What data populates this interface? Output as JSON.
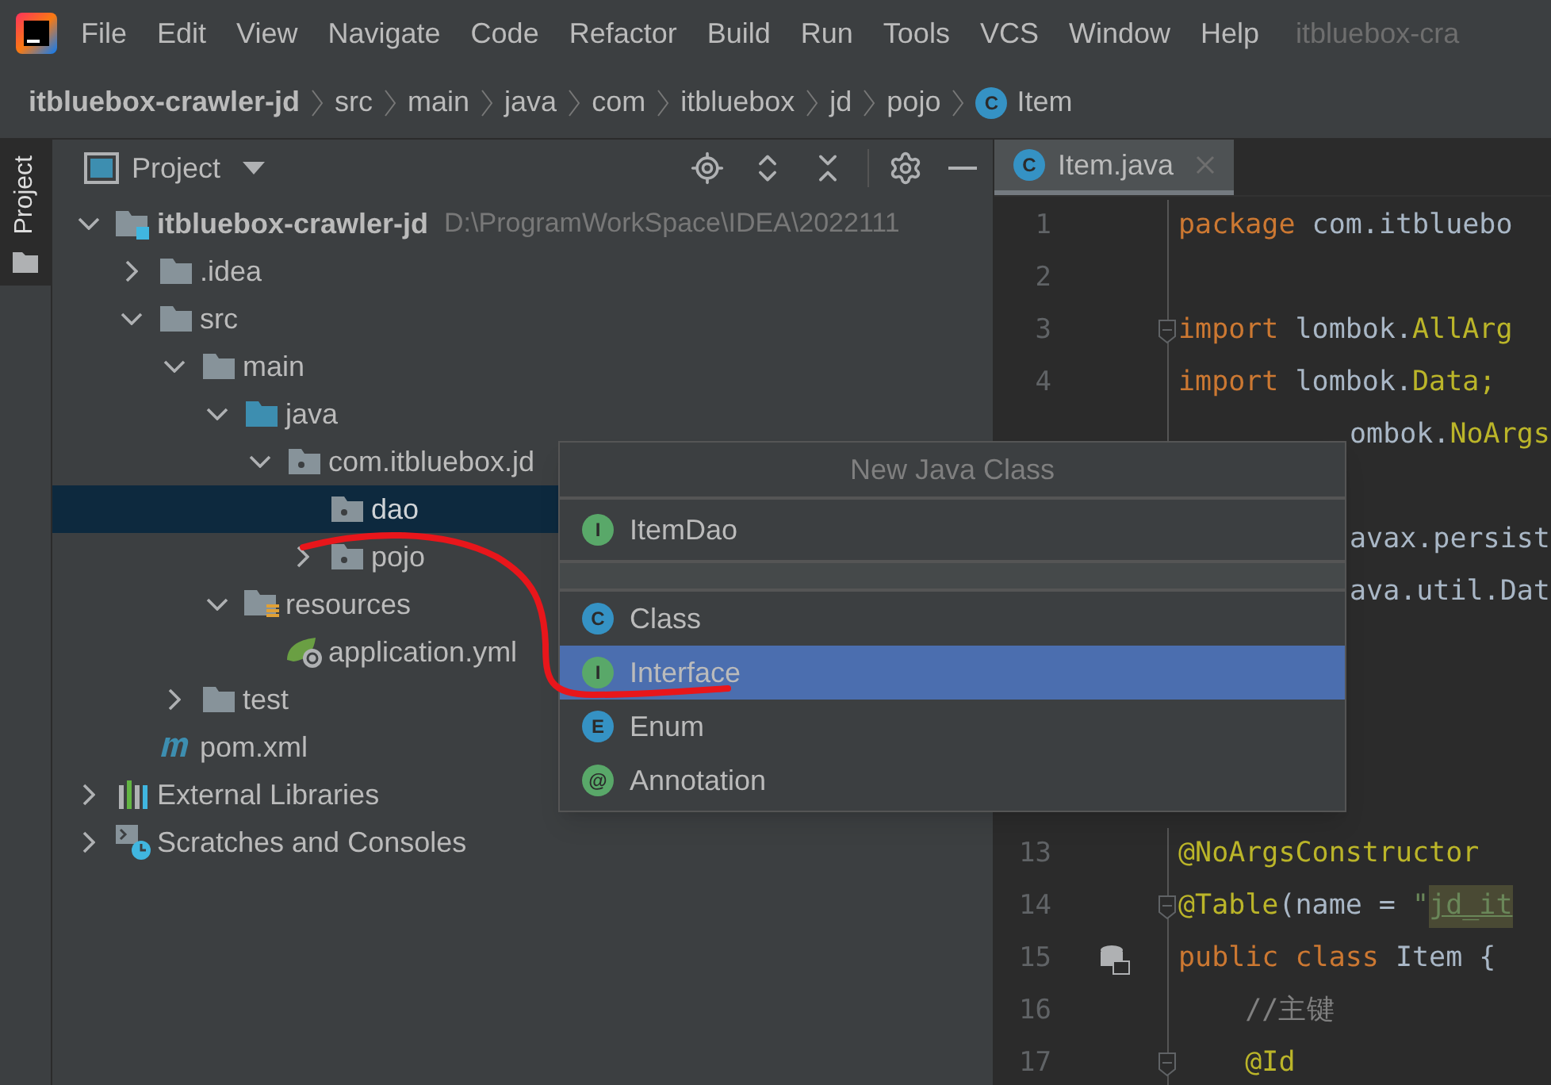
{
  "menu_bar": {
    "items": [
      "File",
      "Edit",
      "View",
      "Navigate",
      "Code",
      "Refactor",
      "Build",
      "Run",
      "Tools",
      "VCS",
      "Window",
      "Help"
    ],
    "window_title": "itbluebox-cra"
  },
  "breadcrumbs": [
    {
      "label": "itbluebox-crawler-jd",
      "kind": "project"
    },
    {
      "label": "src",
      "kind": "folder"
    },
    {
      "label": "main",
      "kind": "folder"
    },
    {
      "label": "java",
      "kind": "folder"
    },
    {
      "label": "com",
      "kind": "folder"
    },
    {
      "label": "itbluebox",
      "kind": "folder"
    },
    {
      "label": "jd",
      "kind": "folder"
    },
    {
      "label": "pojo",
      "kind": "folder"
    },
    {
      "label": "Item",
      "kind": "class",
      "letter": "C"
    }
  ],
  "side_strip": {
    "tab_label": "Project"
  },
  "project_panel": {
    "title": "Project",
    "tree": [
      {
        "label": "itbluebox-crawler-jd",
        "path": "D:\\ProgramWorkSpace\\IDEA\\2022111",
        "kind": "module",
        "expanded": true,
        "selected": false,
        "children": [
          {
            "label": ".idea",
            "kind": "folder",
            "expanded": false,
            "selected": false
          },
          {
            "label": "src",
            "kind": "folder",
            "expanded": true,
            "selected": false,
            "children": [
              {
                "label": "main",
                "kind": "folder",
                "expanded": true,
                "selected": false,
                "children": [
                  {
                    "label": "java",
                    "kind": "source",
                    "expanded": true,
                    "selected": false,
                    "children": [
                      {
                        "label": "com.itbluebox.jd",
                        "kind": "package",
                        "expanded": true,
                        "selected": false,
                        "children": [
                          {
                            "label": "dao",
                            "kind": "package",
                            "selected": true
                          },
                          {
                            "label": "pojo",
                            "kind": "package",
                            "expanded": false,
                            "selected": false
                          }
                        ]
                      }
                    ]
                  },
                  {
                    "label": "resources",
                    "kind": "resources",
                    "expanded": true,
                    "selected": false,
                    "children": [
                      {
                        "label": "application.yml",
                        "kind": "spring",
                        "selected": false
                      }
                    ]
                  }
                ]
              },
              {
                "label": "test",
                "kind": "folder",
                "expanded": false,
                "selected": false
              }
            ]
          },
          {
            "label": "pom.xml",
            "kind": "maven",
            "selected": false
          }
        ]
      },
      {
        "label": "External Libraries",
        "kind": "libraries",
        "expanded": false,
        "selected": false
      },
      {
        "label": "Scratches and Consoles",
        "kind": "scratches",
        "expanded": false,
        "selected": false
      }
    ]
  },
  "editor": {
    "tabs": [
      {
        "label": "Item.java",
        "letter": "C",
        "selected": true
      }
    ],
    "lines": [
      {
        "number": "1",
        "tokens": [
          {
            "text": "package",
            "kind": "keyword"
          },
          {
            "text": " com.itbluebo",
            "kind": "plain"
          }
        ]
      },
      {
        "number": "2"
      },
      {
        "number": "3",
        "fold": true,
        "tokens": [
          {
            "text": "import",
            "kind": "keyword"
          },
          {
            "text": " lombok.",
            "kind": "plain"
          },
          {
            "text": "AllArg",
            "kind": "type"
          }
        ]
      },
      {
        "number": "4",
        "tokens": [
          {
            "text": "import",
            "kind": "keyword"
          },
          {
            "text": " lombok.",
            "kind": "plain"
          },
          {
            "text": "Data;",
            "kind": "type"
          }
        ]
      },
      {
        "covered": true,
        "tokens": [
          {
            "text": "ombok.",
            "kind": "plain"
          },
          {
            "text": "NoArgs",
            "kind": "type"
          }
        ]
      }
    ],
    "lines_right_of_popup": [
      {
        "tokens": [
          {
            "text": "avax.persist",
            "kind": "plain"
          }
        ]
      },
      {
        "tokens": [
          {
            "text": "ava.util.Dat",
            "kind": "plain"
          }
        ]
      }
    ],
    "lines_below_popup": [
      {
        "number": "13",
        "tokens": [
          {
            "text": "@NoArgsConstructor",
            "kind": "annotation"
          }
        ]
      },
      {
        "number": "14",
        "fold": true,
        "tokens": [
          {
            "text": "@Table",
            "kind": "annotation"
          },
          {
            "text": "(name = ",
            "kind": "plain"
          },
          {
            "text": "\"",
            "kind": "string"
          },
          {
            "text": "jd_it",
            "kind": "injected"
          }
        ]
      },
      {
        "number": "15",
        "db_icon": true,
        "tokens": [
          {
            "text": "public class",
            "kind": "keyword"
          },
          {
            "text": " Item {",
            "kind": "plain"
          }
        ]
      },
      {
        "number": "16",
        "tokens": [
          {
            "text": "    //主键",
            "kind": "comment"
          }
        ]
      },
      {
        "number": "17",
        "fold": true,
        "tokens": [
          {
            "text": "    @Id",
            "kind": "annotation"
          }
        ]
      }
    ]
  },
  "popup": {
    "title": "New Java Class",
    "recent": [
      {
        "label": "ItemDao",
        "letter": "I",
        "kind": "interface"
      }
    ],
    "items": [
      {
        "label": "Class",
        "letter": "C",
        "kind": "class",
        "selected": false
      },
      {
        "label": "Interface",
        "letter": "I",
        "kind": "interface",
        "selected": true
      },
      {
        "label": "Enum",
        "letter": "E",
        "kind": "enum",
        "selected": false
      },
      {
        "label": "Annotation",
        "letter": "@",
        "kind": "annotation",
        "selected": false
      }
    ]
  }
}
